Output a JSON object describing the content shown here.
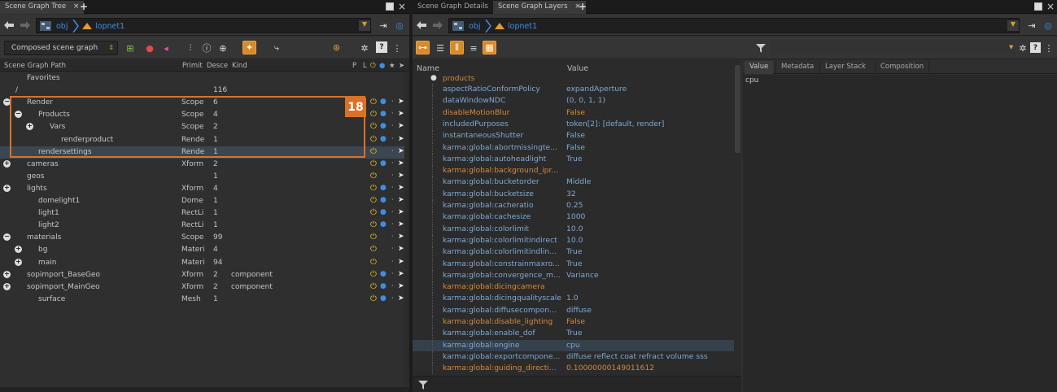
{
  "left_panel": {
    "tab": {
      "label": "Scene Graph Tree",
      "close": "×"
    },
    "path": {
      "crumb": "obj",
      "node": "lopnet1"
    },
    "toolbar": {
      "scene_graph_select": "Composed scene graph"
    },
    "columns": {
      "path": "Scene Graph Path",
      "primitive": "Primit",
      "descendants": "Desce",
      "kind": "Kind",
      "p": "P",
      "l": "L"
    },
    "annotation_badge": "18",
    "rows": [
      {
        "name": "Favorites",
        "prim": "",
        "desc": "",
        "kind": ""
      },
      {
        "name": "/",
        "prim": "",
        "desc": "116",
        "kind": ""
      },
      {
        "name": "Render",
        "prim": "Scope",
        "desc": "6",
        "kind": ""
      },
      {
        "name": "Products",
        "prim": "Scope",
        "desc": "4",
        "kind": ""
      },
      {
        "name": "Vars",
        "prim": "Scope",
        "desc": "2",
        "kind": ""
      },
      {
        "name": "renderproduct",
        "prim": "Rende",
        "desc": "1",
        "kind": ""
      },
      {
        "name": "rendersettings",
        "prim": "Rende",
        "desc": "1",
        "kind": ""
      },
      {
        "name": "cameras",
        "prim": "Xform",
        "desc": "2",
        "kind": ""
      },
      {
        "name": "geos",
        "prim": "",
        "desc": "1",
        "kind": ""
      },
      {
        "name": "lights",
        "prim": "Xform",
        "desc": "4",
        "kind": ""
      },
      {
        "name": "domelight1",
        "prim": "Dome",
        "desc": "1",
        "kind": ""
      },
      {
        "name": "light1",
        "prim": "RectLi",
        "desc": "1",
        "kind": ""
      },
      {
        "name": "light2",
        "prim": "RectLi",
        "desc": "1",
        "kind": ""
      },
      {
        "name": "materials",
        "prim": "Scope",
        "desc": "99",
        "kind": ""
      },
      {
        "name": "bg",
        "prim": "Materi",
        "desc": "4",
        "kind": ""
      },
      {
        "name": "main",
        "prim": "Materi",
        "desc": "94",
        "kind": ""
      },
      {
        "name": "sopimport_BaseGeo",
        "prim": "Xform",
        "desc": "2",
        "kind": "component"
      },
      {
        "name": "sopimport_MainGeo",
        "prim": "Xform",
        "desc": "2",
        "kind": "component"
      },
      {
        "name": "surface",
        "prim": "Mesh",
        "desc": "1",
        "kind": ""
      }
    ]
  },
  "right_panel": {
    "tabs": [
      {
        "label": "Scene Graph Details",
        "close": "×"
      },
      {
        "label": "Scene Graph Layers",
        "close": "×"
      }
    ],
    "path": {
      "crumb": "obj",
      "node": "lopnet1"
    },
    "columns": {
      "name": "Name",
      "value": "Value"
    },
    "group_label": "products",
    "properties": [
      {
        "name": "aspectRatioConformPolicy",
        "value": "expandAperture",
        "orange": false
      },
      {
        "name": "dataWindowNDC",
        "value": "(0, 0, 1, 1)",
        "orange": false
      },
      {
        "name": "disableMotionBlur",
        "value": "False",
        "orange": true
      },
      {
        "name": "includedPurposes",
        "value": "token[2]: [default, render]",
        "orange": false
      },
      {
        "name": "instantaneousShutter",
        "value": "False",
        "orange": false
      },
      {
        "name": "karma:global:abortmissingte...",
        "value": "False",
        "orange": false
      },
      {
        "name": "karma:global:autoheadlight",
        "value": "True",
        "orange": false
      },
      {
        "name": "karma:global:background_ipr...",
        "value": "",
        "orange": true
      },
      {
        "name": "karma:global:bucketorder",
        "value": "Middle",
        "orange": false
      },
      {
        "name": "karma:global:bucketsize",
        "value": "32",
        "orange": false
      },
      {
        "name": "karma:global:cacheratio",
        "value": "0.25",
        "orange": false
      },
      {
        "name": "karma:global:cachesize",
        "value": "1000",
        "orange": false
      },
      {
        "name": "karma:global:colorlimit",
        "value": "10.0",
        "orange": false
      },
      {
        "name": "karma:global:colorlimitindirect",
        "value": "10.0",
        "orange": false
      },
      {
        "name": "karma:global:colorlimitindlin...",
        "value": "True",
        "orange": false
      },
      {
        "name": "karma:global:constrainmaxro...",
        "value": "True",
        "orange": false
      },
      {
        "name": "karma:global:convergence_m...",
        "value": "Variance",
        "orange": false
      },
      {
        "name": "karma:global:dicingcamera",
        "value": "",
        "orange": true
      },
      {
        "name": "karma:global:dicingqualityscale",
        "value": "1.0",
        "orange": false
      },
      {
        "name": "karma:global:diffusecompon...",
        "value": "diffuse",
        "orange": false
      },
      {
        "name": "karma:global:disable_lighting",
        "value": "False",
        "orange": true
      },
      {
        "name": "karma:global:enable_dof",
        "value": "True",
        "orange": false
      },
      {
        "name": "karma:global:engine",
        "value": "cpu",
        "orange": false,
        "selected": true
      },
      {
        "name": "karma:global:exportcompone...",
        "value": "diffuse reflect coat refract volume sss",
        "orange": false
      },
      {
        "name": "karma:global:guiding_directi...",
        "value": "0.10000000149011612",
        "orange": true
      }
    ],
    "value_tabs": [
      "Value",
      "Metadata",
      "Layer Stack",
      "Composition"
    ],
    "value_text": "cpu"
  }
}
